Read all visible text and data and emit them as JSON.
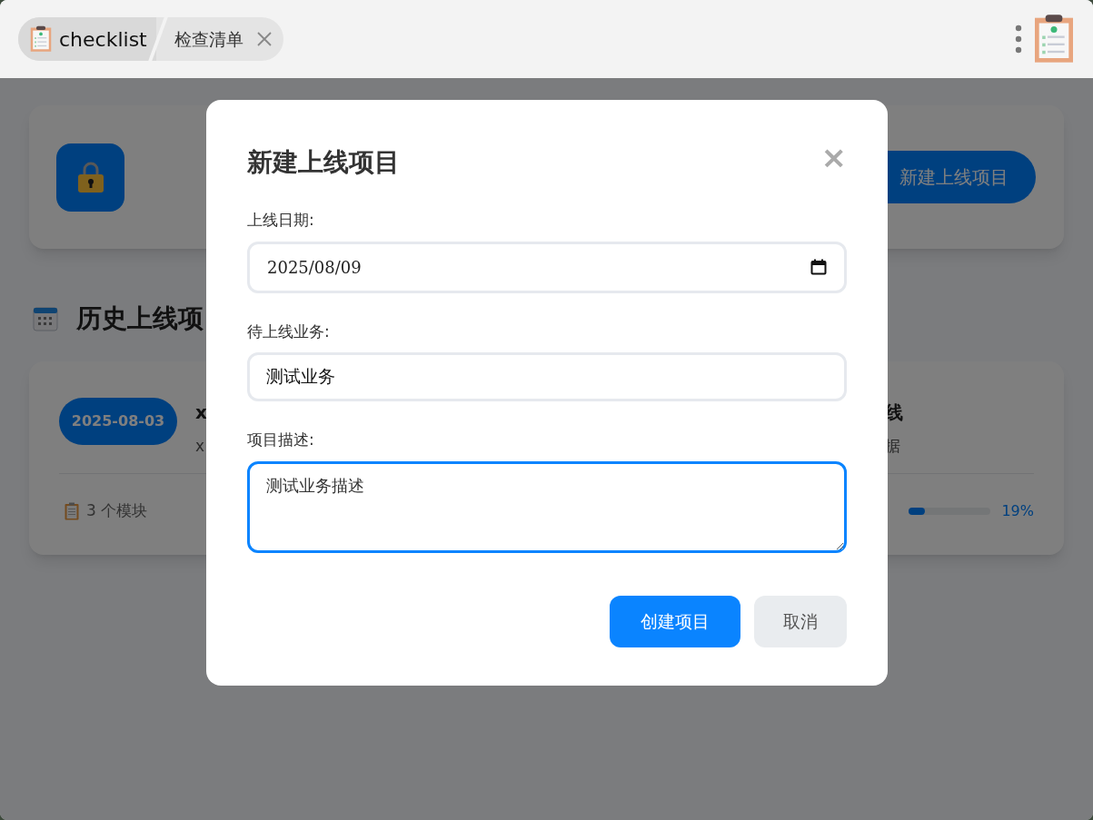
{
  "titlebar": {
    "app_name": "checklist",
    "tab": {
      "label": "检查清单",
      "selected": true
    }
  },
  "header": {
    "button": "新建上线项目"
  },
  "section": {
    "title": "历史上线项"
  },
  "project": {
    "date": "2025-08-03",
    "title_left": "x",
    "desc_left": "x",
    "title_right": "线",
    "desc_right": "据",
    "modules": "3 个模块",
    "level": 0.19,
    "percent": "19%"
  },
  "modal": {
    "title": "新建上线项目",
    "close": "×",
    "fields": [
      {
        "kind": "date",
        "label": "上线日期:",
        "value": "2025/08/09",
        "focused": false
      },
      {
        "kind": "text",
        "label": "待上线业务:",
        "value": "测试业务",
        "focused": false
      },
      {
        "kind": "textarea",
        "label": "项目描述:",
        "value": "测试业务描述",
        "focused": true
      }
    ],
    "buttons": [
      {
        "kind": "primary",
        "label": "创建项目"
      },
      {
        "kind": "secondary",
        "label": "取消"
      }
    ]
  }
}
